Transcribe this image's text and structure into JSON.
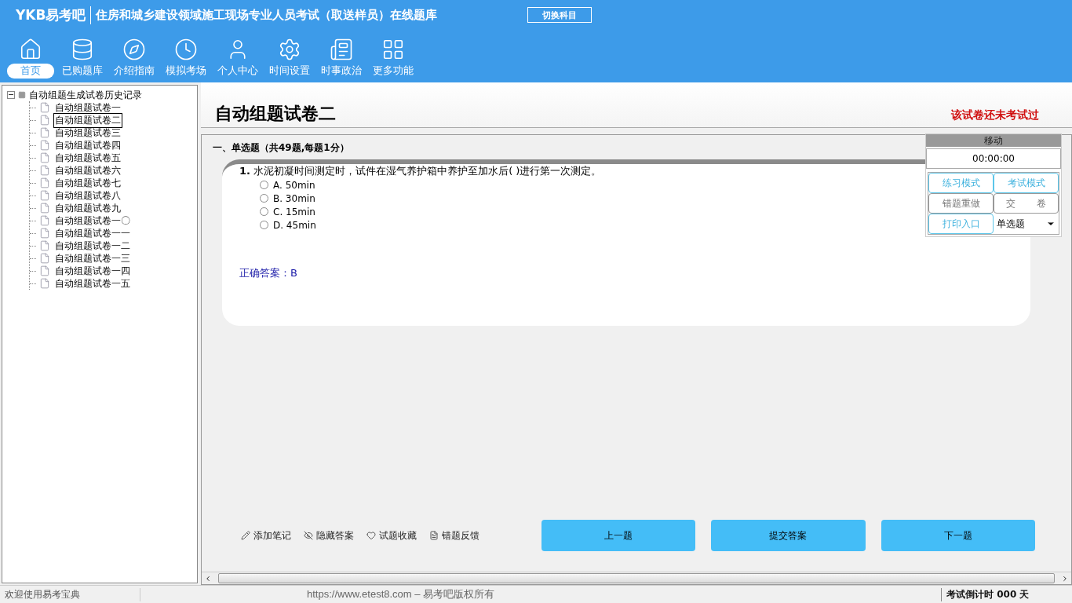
{
  "header": {
    "brand": "YKB易考吧",
    "title": "住房和城乡建设领域施工现场专业人员考试（取送样员）在线题库",
    "switch_button": "切换科目"
  },
  "nav": [
    {
      "label": "首页",
      "selected": true
    },
    {
      "label": "已购题库",
      "selected": false
    },
    {
      "label": "介绍指南",
      "selected": false
    },
    {
      "label": "模拟考场",
      "selected": false
    },
    {
      "label": "个人中心",
      "selected": false
    },
    {
      "label": "时间设置",
      "selected": false
    },
    {
      "label": "时事政治",
      "selected": false
    },
    {
      "label": "更多功能",
      "selected": false
    }
  ],
  "tree": {
    "label": "自动组题生成试卷历史记录",
    "expanded": true,
    "children": [
      {
        "label": "自动组题试卷一",
        "selected": false
      },
      {
        "label": "自动组题试卷二",
        "selected": true
      },
      {
        "label": "自动组题试卷三",
        "selected": false
      },
      {
        "label": "自动组题试卷四",
        "selected": false
      },
      {
        "label": "自动组题试卷五",
        "selected": false
      },
      {
        "label": "自动组题试卷六",
        "selected": false
      },
      {
        "label": "自动组题试卷七",
        "selected": false
      },
      {
        "label": "自动组题试卷八",
        "selected": false
      },
      {
        "label": "自动组题试卷九",
        "selected": false
      },
      {
        "label": "自动组题试卷一〇",
        "selected": false
      },
      {
        "label": "自动组题试卷一一",
        "selected": false
      },
      {
        "label": "自动组题试卷一二",
        "selected": false
      },
      {
        "label": "自动组题试卷一三",
        "selected": false
      },
      {
        "label": "自动组题试卷一四",
        "selected": false
      },
      {
        "label": "自动组题试卷一五",
        "selected": false
      }
    ]
  },
  "exam": {
    "title": "自动组题试卷二",
    "status": "该试卷还未考试过",
    "section": "一、单选题（共49题,每题1分）"
  },
  "question": {
    "number": "1.",
    "text": "水泥初凝时间测定时，试件在湿气养护箱中养护至加水后(  )进行第一次测定。",
    "options": [
      {
        "label": "A. 50min",
        "selected": false
      },
      {
        "label": "B. 30min",
        "selected": false
      },
      {
        "label": "C. 15min",
        "selected": false
      },
      {
        "label": "D. 45min",
        "selected": false
      }
    ],
    "answer_label": "正确答案：",
    "answer": "B"
  },
  "side_panel": {
    "move": "移动",
    "timer": "00:00:00",
    "buttons": [
      {
        "label": "练习模式",
        "kind": "primary"
      },
      {
        "label": "考试模式",
        "kind": "primary"
      },
      {
        "label": "错题重做",
        "kind": "secondary"
      },
      {
        "label": "交 卷",
        "kind": "secondary"
      },
      {
        "label": "打印入口",
        "kind": "primary"
      }
    ],
    "select": "单选题"
  },
  "tools": [
    "添加笔记",
    "隐藏答案",
    "试题收藏",
    "错题反馈"
  ],
  "nav_buttons": [
    "上一题",
    "提交答案",
    "下一题"
  ],
  "status_bar": {
    "welcome": "欢迎使用易考宝典",
    "copyright": "https://www.etest8.com – 易考吧版权所有",
    "countdown": "考试倒计时 000 天"
  }
}
